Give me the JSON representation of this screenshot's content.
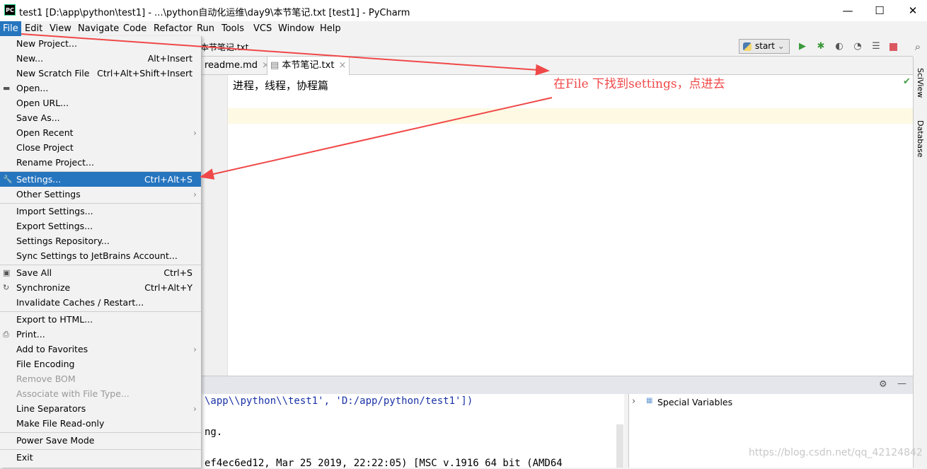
{
  "title": "test1 [D:\\app\\python\\test1] - ...\\python自动化运维\\day9\\本节笔记.txt [test1] - PyCharm",
  "logo": "PC",
  "window_controls": {
    "minimize": "—",
    "maximize": "☐",
    "close": "✕"
  },
  "menubar": [
    "File",
    "Edit",
    "View",
    "Navigate",
    "Code",
    "Refactor",
    "Run",
    "Tools",
    "VCS",
    "Window",
    "Help"
  ],
  "breadcrumb": "本节笔记.txt",
  "run_config": "start",
  "tabs": [
    {
      "label": "readme.md",
      "close": "×"
    },
    {
      "label": "本节笔记.txt",
      "close": "×"
    }
  ],
  "editor_text": "进程，线程，协程篇",
  "right_panel": [
    "SciView",
    "Database"
  ],
  "console_lines": [
    "\\app\\\\python\\\\test1', 'D:/app/python/test1'])",
    "ng.",
    "ef4ec6ed12, Mar 25 2019, 22:22:05) [MSC v.1916 64 bit (AMD64"
  ],
  "variables": {
    "label": "Special Variables"
  },
  "annotation": "在File 下找到settings，点进去",
  "watermark": "https://blog.csdn.net/qq_42124842",
  "file_menu": [
    {
      "label": "New Project..."
    },
    {
      "label": "New...",
      "shortcut": "Alt+Insert"
    },
    {
      "label": "New Scratch File",
      "shortcut": "Ctrl+Alt+Shift+Insert"
    },
    {
      "label": "Open...",
      "icon": "folder"
    },
    {
      "label": "Open URL..."
    },
    {
      "label": "Save As..."
    },
    {
      "label": "Open Recent",
      "submenu": true
    },
    {
      "label": "Close Project"
    },
    {
      "label": "Rename Project..."
    },
    {
      "sep": true
    },
    {
      "label": "Settings...",
      "shortcut": "Ctrl+Alt+S",
      "icon": "wrench",
      "highlighted": true
    },
    {
      "label": "Other Settings",
      "submenu": true
    },
    {
      "sep": true
    },
    {
      "label": "Import Settings..."
    },
    {
      "label": "Export Settings..."
    },
    {
      "label": "Settings Repository..."
    },
    {
      "label": "Sync Settings to JetBrains Account..."
    },
    {
      "sep": true
    },
    {
      "label": "Save All",
      "shortcut": "Ctrl+S",
      "icon": "save"
    },
    {
      "label": "Synchronize",
      "shortcut": "Ctrl+Alt+Y",
      "icon": "sync"
    },
    {
      "label": "Invalidate Caches / Restart..."
    },
    {
      "sep": true
    },
    {
      "label": "Export to HTML..."
    },
    {
      "label": "Print...",
      "icon": "print"
    },
    {
      "label": "Add to Favorites",
      "submenu": true
    },
    {
      "label": "File Encoding"
    },
    {
      "label": "Remove BOM",
      "disabled": true
    },
    {
      "label": "Associate with File Type...",
      "disabled": true
    },
    {
      "label": "Line Separators",
      "submenu": true
    },
    {
      "label": "Make File Read-only"
    },
    {
      "sep": true
    },
    {
      "label": "Power Save Mode"
    },
    {
      "sep": true
    },
    {
      "label": "Exit"
    }
  ],
  "colors": {
    "accent": "#2675bf",
    "annotation": "#f04848"
  }
}
